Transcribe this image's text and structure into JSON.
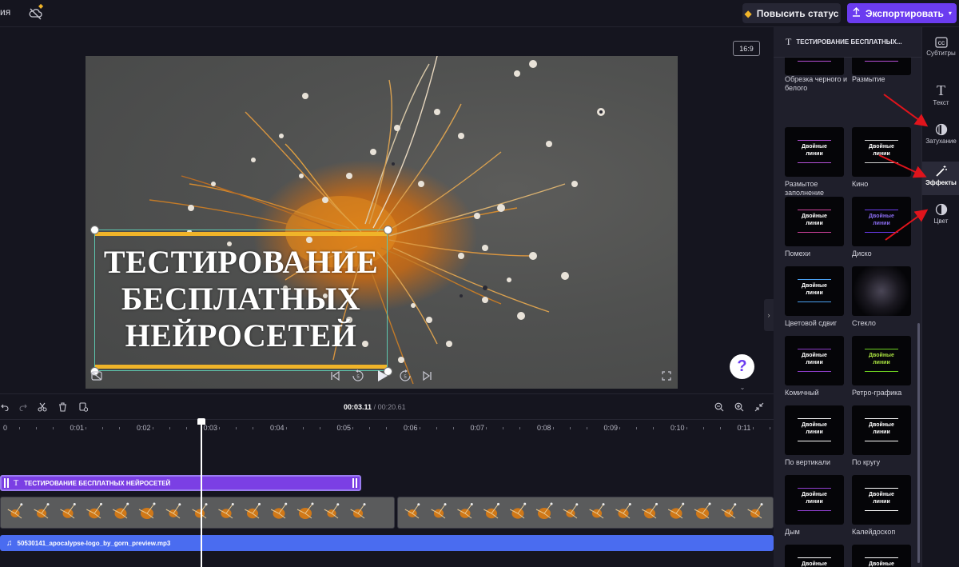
{
  "topbar": {
    "left_tab": "ия",
    "upgrade_label": "Повысить статус",
    "export_label": "Экспортировать",
    "aspect_ratio": "16:9"
  },
  "video_overlay": {
    "line1": "ТЕСТИРОВАНИЕ",
    "line2": "БЕСПЛАТНЫХ",
    "line3": "НЕЙРОСЕТЕЙ"
  },
  "help_label": "?",
  "timeline": {
    "current_time": "00:03.11",
    "separator": "/",
    "total_time": "00:20.61",
    "ticks": [
      "0",
      "0:01",
      "0:02",
      "0:03",
      "0:04",
      "0:05",
      "0:06",
      "0:07",
      "0:08",
      "0:09",
      "0:10",
      "0:11"
    ],
    "playhead_fraction": 0.2,
    "text_clip_label": "ТЕСТИРОВАНИЕ БЕСПЛАТНЫХ НЕЙРОСЕТЕЙ",
    "audio_clip_label": "50530141_apocalypse-logo_by_gorn_preview.mp3"
  },
  "panel": {
    "header": "ТЕСТИРОВАНИЕ БЕСПЛАТНЫХ...",
    "thumb_text_line1": "Двойные",
    "thumb_text_line2": "линии",
    "effects": [
      {
        "label": "Обрезка черного и белого",
        "accent": "#b44fd6"
      },
      {
        "label": "Размытие",
        "accent": "#b44fd6"
      },
      {
        "label": "Размытое заполнение",
        "accent": "#b44fd6"
      },
      {
        "label": "Кино",
        "accent": "#cfcfcf"
      },
      {
        "label": "Помехи",
        "accent": "#d0409c"
      },
      {
        "label": "Диско",
        "accent": "#6b3cf0"
      },
      {
        "label": "Цветовой сдвиг",
        "accent": "#4aa0f0"
      },
      {
        "label": "Стекло",
        "accent": "#cfcfcf"
      },
      {
        "label": "Комичный",
        "accent": "#8c3cc8"
      },
      {
        "label": "Ретро-графика",
        "accent": "#6cd020"
      },
      {
        "label": "По вертикали",
        "accent": "#ffffff"
      },
      {
        "label": "По кругу",
        "accent": "#ffffff"
      },
      {
        "label": "Дым",
        "accent": "#9040d0"
      },
      {
        "label": "Калейдоскоп",
        "accent": "#ffffff"
      },
      {
        "label": "",
        "accent": "#ffffff"
      },
      {
        "label": "",
        "accent": "#ffffff"
      }
    ]
  },
  "rail": {
    "items": [
      {
        "label": "Субтитры",
        "icon": "captions-icon"
      },
      {
        "label": "Текст",
        "icon": "text-icon"
      },
      {
        "label": "Затухание",
        "icon": "fade-icon"
      },
      {
        "label": "Эффекты",
        "icon": "magic-wand-icon"
      },
      {
        "label": "Цвет",
        "icon": "color-icon"
      }
    ]
  },
  "colors": {
    "accent_purple": "#6b3cf0",
    "text_clip": "#7b3fe4",
    "audio_clip": "#4a6cf0",
    "selection_bar": "#f0b429",
    "annotation_arrow": "#e0141c"
  }
}
